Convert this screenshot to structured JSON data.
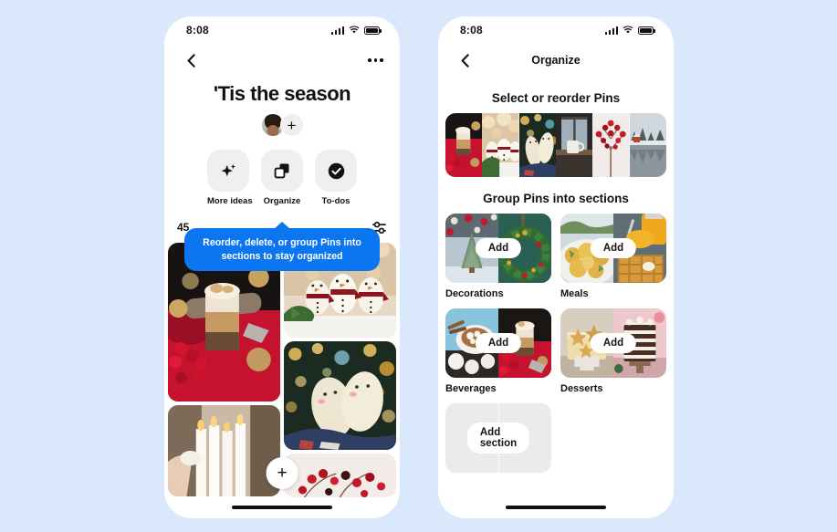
{
  "background_color": "#d9e8fb",
  "accent_color": "#0b76ef",
  "phones": {
    "left": {
      "status": {
        "time": "8:08",
        "signal_icon": "cellular-signal-icon",
        "wifi_icon": "wifi-icon",
        "battery_icon": "battery-icon"
      },
      "nav": {
        "back_icon": "chevron-left-icon",
        "more_icon": "overflow-menu-icon",
        "title": ""
      },
      "board": {
        "title": "'Tis the season",
        "avatar_name": "board-owner-avatar",
        "add_collaborator_label": "+"
      },
      "actions": [
        {
          "label": "More ideas",
          "icon": "sparkle-icon"
        },
        {
          "label": "Organize",
          "icon": "organize-squares-icon"
        },
        {
          "label": "To-dos",
          "icon": "check-circle-icon"
        }
      ],
      "count_row": {
        "count_text": "45",
        "filter_icon": "filter-sliders-icon"
      },
      "tooltip": {
        "text": "Reorder, delete, or group  Pins into sections to stay organized"
      },
      "fab_label": "+",
      "pins": [
        {
          "name": "pin-latte-berries"
        },
        {
          "name": "pin-snowman-eggs"
        },
        {
          "name": "pin-cozy-socks"
        },
        {
          "name": "pin-white-candles"
        },
        {
          "name": "pin-red-berries"
        }
      ]
    },
    "right": {
      "status": {
        "time": "8:08",
        "signal_icon": "cellular-signal-icon",
        "wifi_icon": "wifi-icon",
        "battery_icon": "battery-icon"
      },
      "nav": {
        "back_icon": "chevron-left-icon",
        "title": "Organize"
      },
      "headings": {
        "select_reorder": "Select or reorder Pins",
        "group_sections": "Group Pins into sections"
      },
      "reorder_strip": [
        {
          "name": "thumb-latte-berries"
        },
        {
          "name": "thumb-snowman-bokeh"
        },
        {
          "name": "thumb-cozy-socks"
        },
        {
          "name": "thumb-window-mug"
        },
        {
          "name": "thumb-berry-branch"
        },
        {
          "name": "thumb-winter-lake"
        }
      ],
      "sections": [
        {
          "label": "Decorations",
          "add_label": "Add"
        },
        {
          "label": "Meals",
          "add_label": "Add"
        },
        {
          "label": "Beverages",
          "add_label": "Add"
        },
        {
          "label": "Desserts",
          "add_label": "Add"
        }
      ],
      "add_section": {
        "label": "Add section"
      }
    }
  }
}
